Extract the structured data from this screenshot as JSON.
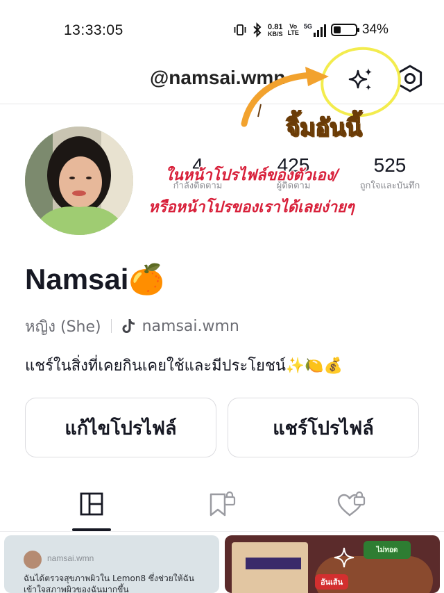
{
  "status_bar": {
    "time": "13:33:05",
    "net_speed_value": "0.81",
    "net_speed_unit": "KB/S",
    "volte_top": "Vo",
    "volte_bottom": "LTE",
    "network": "5G",
    "battery_percent": "34%",
    "battery_level": 0.34,
    "icons": [
      "vibrate-icon",
      "bluetooth-icon",
      "net-speed-icon",
      "volte-icon",
      "signal-5g-icon",
      "battery-icon"
    ]
  },
  "header": {
    "username": "@namsai.wmn",
    "icons": [
      "sparkle-icon",
      "settings-gear-icon"
    ]
  },
  "annotation": {
    "tap_text": "จิ้มอันนี้",
    "caption_line1": "ในหน้าโปรไฟล์ของตัวเอง/",
    "caption_line2": "หรือหน้าโปรของเราได้เลยง่ายๆ",
    "highlight_color": "#f3ec4e",
    "arrow_color": "#f2a22e"
  },
  "profile": {
    "display_name": "Namsai🍊",
    "pronoun": "หญิง (She)",
    "tiktok_handle": "namsai.wmn",
    "bio": "แชร์ในสิ่งที่เคยกินเคยใช้และมีประโยชน์✨🍋💰",
    "stats": [
      {
        "value": "4",
        "label": "กำลังติดตาม"
      },
      {
        "value": "425",
        "label": "ผู้ติดตาม"
      },
      {
        "value": "525",
        "label": "ถูกใจและบันทึก"
      }
    ]
  },
  "buttons": {
    "edit_profile": "แก้ไขโปรไฟล์",
    "share_profile": "แชร์โปรไฟล์"
  },
  "tabs": [
    {
      "name": "posts",
      "icon": "grid-layout-icon",
      "active": true
    },
    {
      "name": "saved",
      "icon": "bookmark-lock-icon",
      "active": false
    },
    {
      "name": "liked",
      "icon": "heart-lock-icon",
      "active": false
    }
  ],
  "posts": [
    {
      "author": "namsai.wmn",
      "text": "ฉันได้ตรวจสุขภาพผิวใน Lemon8 ซึ่งช่วยให้ฉันเข้าใจสภาพผิวของฉันมากขึ้น"
    },
    {
      "badge": "ไม่ทอด",
      "sticker": "อันเส้น"
    }
  ]
}
